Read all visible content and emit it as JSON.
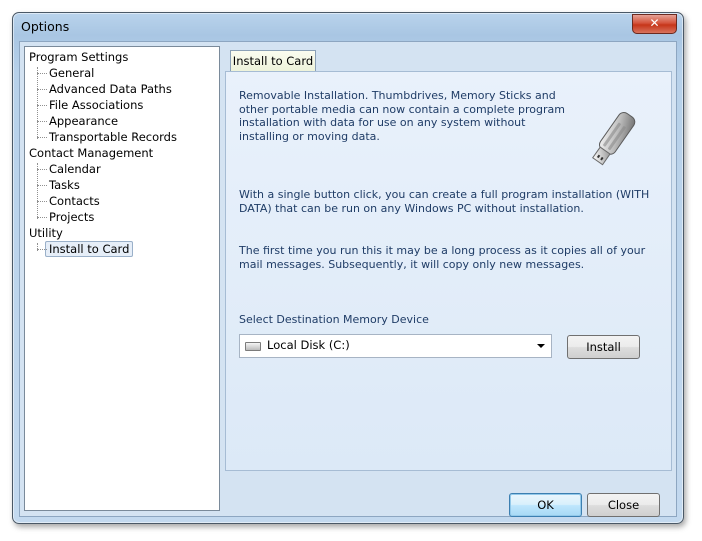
{
  "window": {
    "title": "Options",
    "close_glyph": "✕"
  },
  "tree": {
    "groups": [
      {
        "label": "Program Settings",
        "children": [
          "General",
          "Advanced Data Paths",
          "File Associations",
          "Appearance",
          "Transportable Records"
        ]
      },
      {
        "label": "Contact Management",
        "children": [
          "Calendar",
          "Tasks",
          "Contacts",
          "Projects"
        ]
      },
      {
        "label": "Utility",
        "children": [
          "Install to Card"
        ]
      }
    ],
    "selected": "Install to Card"
  },
  "tab": {
    "label": "Install to Card"
  },
  "content": {
    "para1": "Removable Installation.  Thumbdrives, Memory Sticks and other portable media can now contain a complete program installation with data for use on any system without installing or moving data.",
    "para2": "With a single button click,  you can create a full program installation (WITH DATA) that can be run on any Windows PC without installation.",
    "para3": "The first time you run this it may be a long process as it copies all of your mail messages.  Subsequently, it will copy only new messages.",
    "select_label": "Select Destination Memory Device",
    "device_selected": "Local Disk (C:)",
    "install_label": "Install"
  },
  "footer": {
    "ok_label": "OK",
    "close_label": "Close"
  },
  "icons": {
    "drive": "hard-drive-icon",
    "usb": "usb-drive-icon",
    "dropdown": "chevron-down-icon"
  }
}
